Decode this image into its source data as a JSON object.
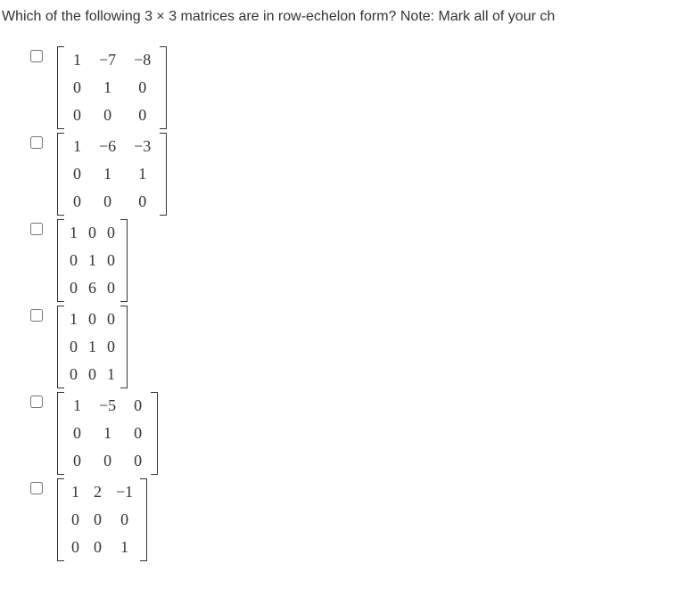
{
  "question": "Which of the following 3 × 3 matrices are in row-echelon form? Note: Mark all of your ch",
  "options": [
    {
      "wide": true,
      "rows": [
        [
          "1",
          "−7",
          "−8"
        ],
        [
          "0",
          "1",
          "0"
        ],
        [
          "0",
          "0",
          "0"
        ]
      ]
    },
    {
      "wide": true,
      "rows": [
        [
          "1",
          "−6",
          "−3"
        ],
        [
          "0",
          "1",
          "1"
        ],
        [
          "0",
          "0",
          "0"
        ]
      ]
    },
    {
      "narrow": true,
      "rows": [
        [
          "1",
          "0",
          "0"
        ],
        [
          "0",
          "1",
          "0"
        ],
        [
          "0",
          "6",
          "0"
        ]
      ]
    },
    {
      "narrow": true,
      "rows": [
        [
          "1",
          "0",
          "0"
        ],
        [
          "0",
          "1",
          "0"
        ],
        [
          "0",
          "0",
          "1"
        ]
      ]
    },
    {
      "wide": true,
      "rows": [
        [
          "1",
          "−5",
          "0"
        ],
        [
          "0",
          "1",
          "0"
        ],
        [
          "0",
          "0",
          "0"
        ]
      ]
    },
    {
      "rows": [
        [
          "1",
          "2",
          "−1"
        ],
        [
          "0",
          "0",
          "0"
        ],
        [
          "0",
          "0",
          "1"
        ]
      ]
    }
  ]
}
